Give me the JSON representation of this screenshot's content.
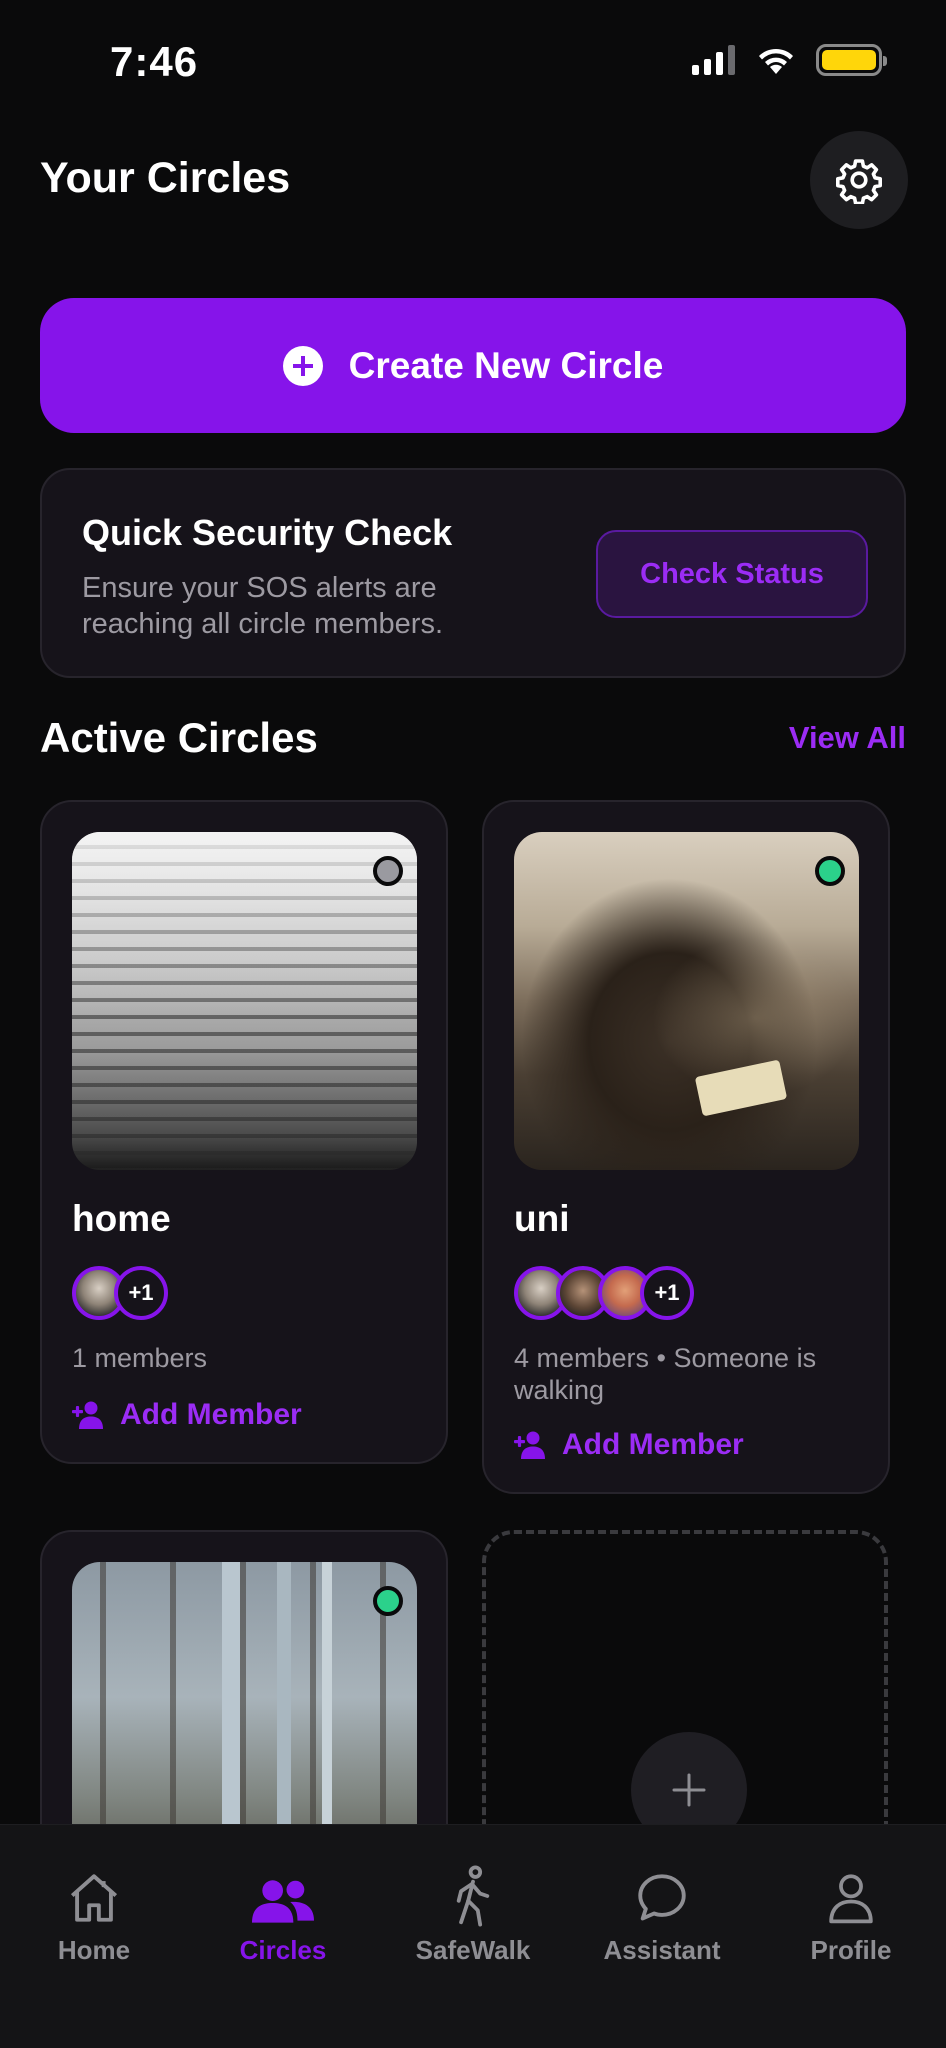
{
  "status_bar": {
    "time": "7:46"
  },
  "header": {
    "title": "Your Circles",
    "settings_icon": "gear-icon"
  },
  "create_button": {
    "label": "Create New Circle",
    "icon": "plus-circle-icon"
  },
  "security_check": {
    "title": "Quick Security Check",
    "description": "Ensure your SOS alerts are reaching all circle members.",
    "button_label": "Check Status"
  },
  "active_circles": {
    "title": "Active Circles",
    "view_all": "View All",
    "circles": [
      {
        "name": "home",
        "members_text": "1 members",
        "extra_members": "+1",
        "add_label": "Add Member",
        "status_color": "#9a9aa0"
      },
      {
        "name": "uni",
        "members_text": "4 members • Someone is walking",
        "extra_members": "+1",
        "add_label": "Add Member",
        "status_color": "#2bd18b"
      },
      {
        "status_color": "#2bd18b"
      }
    ]
  },
  "colors": {
    "accent": "#8614ea",
    "accent_text": "#9b2cf5",
    "online": "#2bd18b",
    "offline": "#9a9aa0"
  },
  "tabs": [
    {
      "label": "Home",
      "icon": "home-icon",
      "active": false
    },
    {
      "label": "Circles",
      "icon": "people-icon",
      "active": true
    },
    {
      "label": "SafeWalk",
      "icon": "walking-icon",
      "active": false
    },
    {
      "label": "Assistant",
      "icon": "chat-bubble-icon",
      "active": false
    },
    {
      "label": "Profile",
      "icon": "person-icon",
      "active": false
    }
  ]
}
